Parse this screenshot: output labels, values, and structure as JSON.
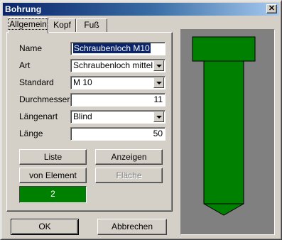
{
  "window": {
    "title": "Bohrung",
    "close_glyph": "✕"
  },
  "tabs": [
    {
      "label": "Allgemein",
      "active": true
    },
    {
      "label": "Kopf",
      "active": false
    },
    {
      "label": "Fuß",
      "active": false
    }
  ],
  "form": {
    "name": {
      "label": "Name",
      "value": "Schraubenloch M10"
    },
    "art": {
      "label": "Art",
      "value": "Schraubenloch mittel"
    },
    "standard": {
      "label": "Standard",
      "value": "M 10"
    },
    "durchmesser": {
      "label": "Durchmesser",
      "value": "11"
    },
    "laengenart": {
      "label": "Längenart",
      "value": "Blind"
    },
    "laenge": {
      "label": "Länge",
      "value": "50"
    }
  },
  "buttons": {
    "liste": "Liste",
    "anzeigen": "Anzeigen",
    "von_element": "von Element",
    "flaeche": "Fläche",
    "ok": "OK",
    "abbrechen": "Abbrechen"
  },
  "color_swatch": {
    "value": "2",
    "color": "#008000"
  },
  "preview": {
    "background": "#808080",
    "hole_color": "#008000",
    "outline_color": "#000000"
  }
}
